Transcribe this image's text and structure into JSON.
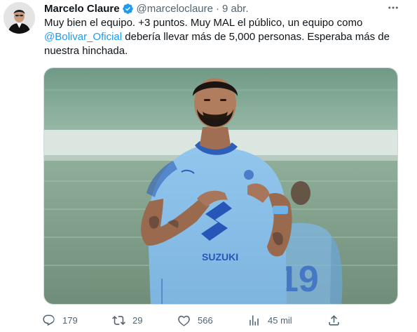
{
  "tweet": {
    "author": {
      "display_name": "Marcelo Claure",
      "handle": "@marceloclaure",
      "verified": true,
      "avatar_icon": "avatar"
    },
    "separator": "·",
    "date": "9 abr.",
    "text": {
      "line1": "Muy bien el equipo.  +3 puntos. Muy MAL el público, un equipo como",
      "mention": "@Bolivar_Oficial",
      "line2_rest": " debería llevar más de 5,000 personas.  Esperaba más de",
      "line3": "nuestra hinchada."
    },
    "media": {
      "jersey_sponsor": "SUZUKI",
      "jersey_number": "19",
      "jersey_color": "#8ec3ea"
    },
    "actions": {
      "replies": "179",
      "reposts": "29",
      "likes": "566",
      "views": "45 mil"
    }
  },
  "colors": {
    "text": "#0f1419",
    "secondary": "#536471",
    "link": "#1d9bf0",
    "verified_badge": "#1d9bf0",
    "border": "#cfd9de"
  }
}
